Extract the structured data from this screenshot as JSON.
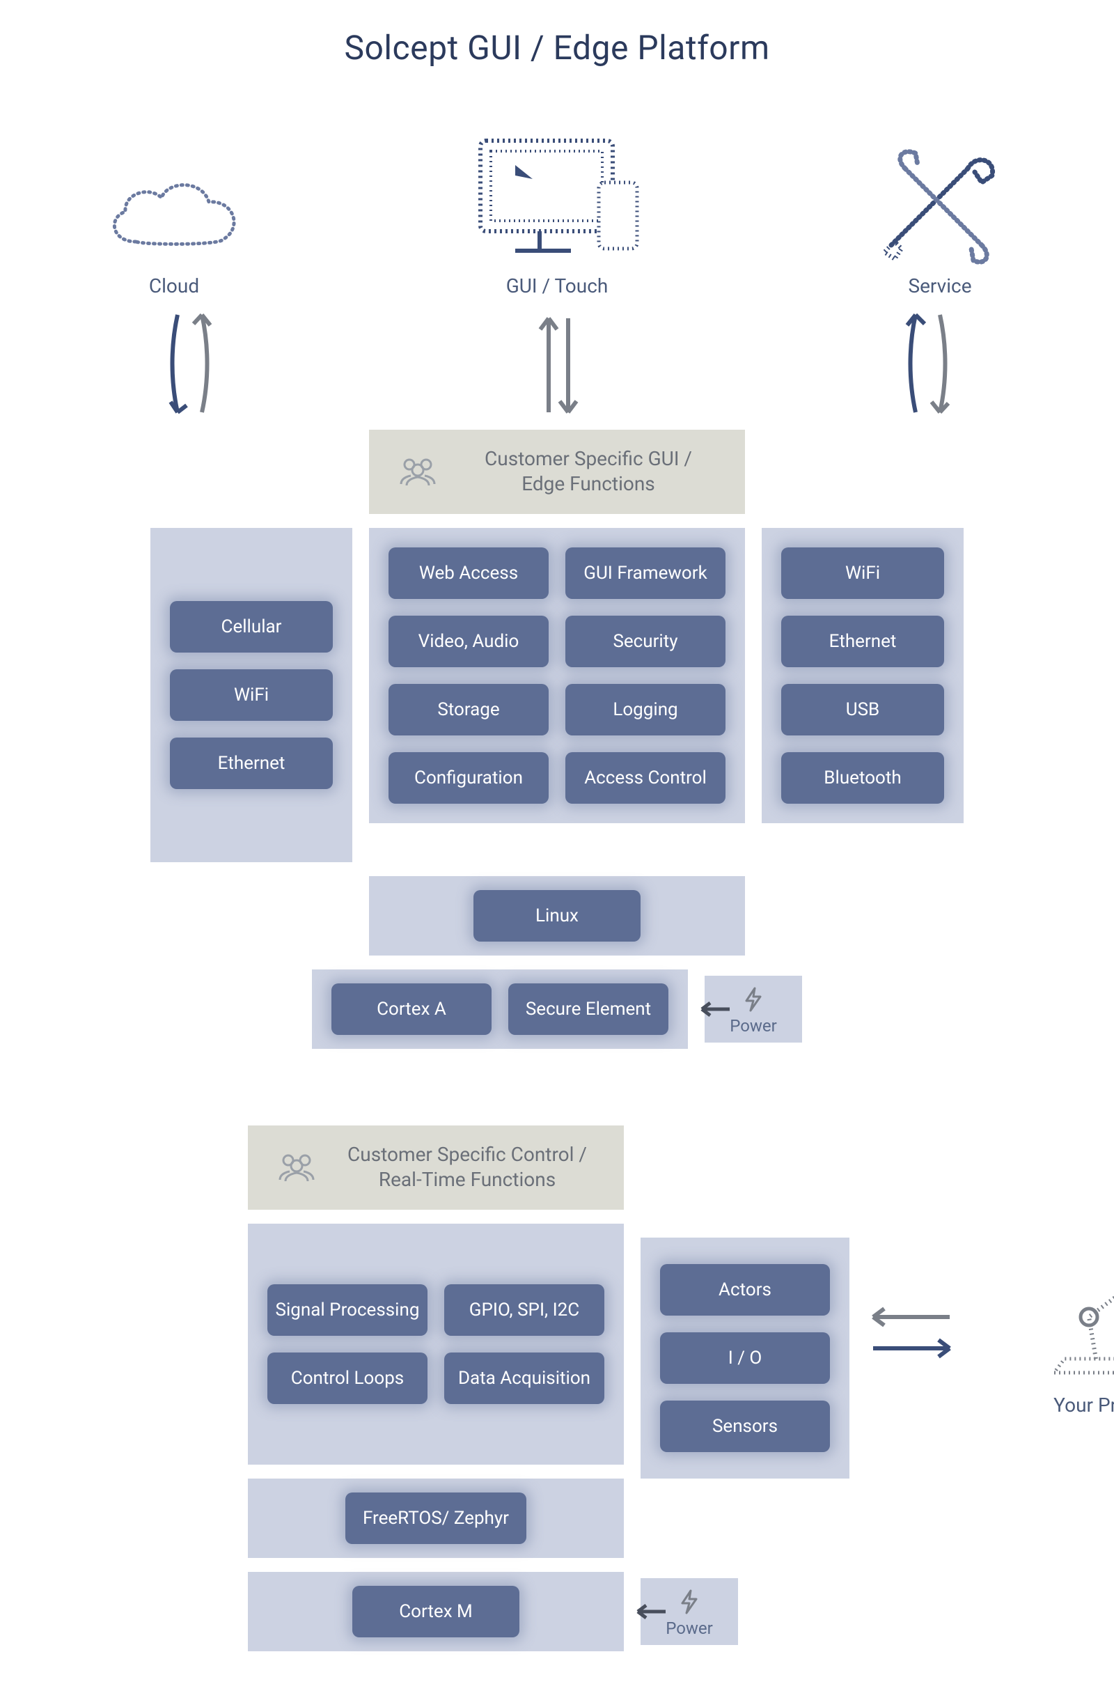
{
  "title": "Solcept GUI / Edge Platform",
  "top": {
    "cloud": "Cloud",
    "gui": "GUI / Touch",
    "service": "Service"
  },
  "customer_gui_header": "Customer Specific GUI /\nEdge Functions",
  "cloud_conn": [
    "Cellular",
    "WiFi",
    "Ethernet"
  ],
  "gui_funcs": {
    "left": [
      "Web Access",
      "Video, Audio",
      "Storage",
      "Configuration"
    ],
    "right": [
      "GUI Framework",
      "Security",
      "Logging",
      "Access Control"
    ]
  },
  "service_conn": [
    "WiFi",
    "Ethernet",
    "USB",
    "Bluetooth"
  ],
  "os_a": "Linux",
  "hw_a": [
    "Cortex A",
    "Secure Element"
  ],
  "power": "Power",
  "customer_rt_header": "Customer Specific Control /\nReal-Time Functions",
  "rt_funcs": {
    "left": [
      "Signal Processing",
      "Control Loops"
    ],
    "right": [
      "GPIO, SPI, I2C",
      "Data Acquisition"
    ]
  },
  "io": [
    "Actors",
    "I / O",
    "Sensors"
  ],
  "product": "Your Product",
  "os_m": "FreeRTOS/ Zephyr",
  "hw_m": "Cortex M"
}
